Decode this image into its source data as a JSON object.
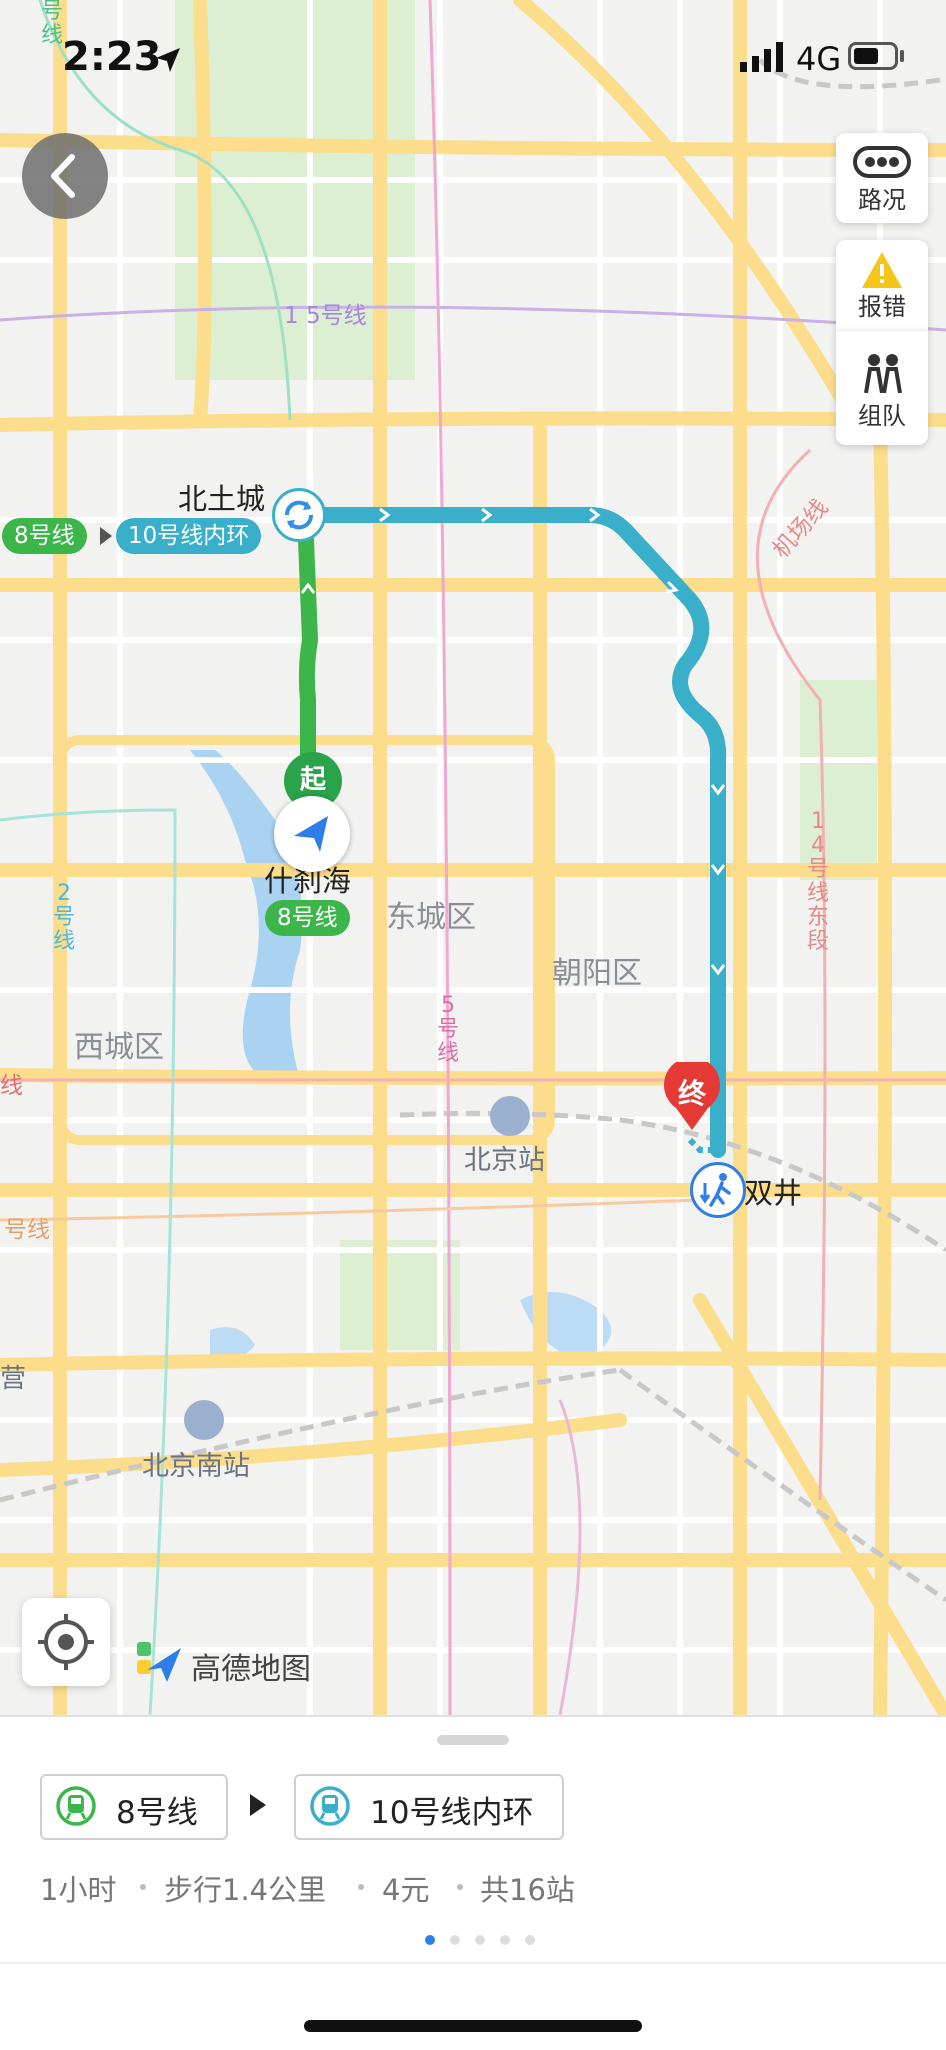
{
  "status_bar": {
    "time": "2:23",
    "network": "4G",
    "location_arrow_icon": "location-arrow-icon",
    "signal_icon": "signal-bars-icon",
    "battery_icon": "battery-icon"
  },
  "map": {
    "buttons": {
      "back_icon": "chevron-left-icon",
      "traffic_label": "路况",
      "report_label": "报错",
      "team_label": "组队",
      "locate_icon": "crosshair-icon"
    },
    "brand": "高德地图",
    "stations": {
      "start_name": "什刹海",
      "transfer_name": "北土城",
      "end_name": "双井",
      "start_marker": "起",
      "end_marker": "终"
    },
    "route_tags": {
      "line8": "8号线",
      "line10": "10号线内环",
      "line8_at_start": "8号线"
    },
    "districts": [
      "东城区",
      "朝阳区",
      "西城区"
    ],
    "poi": {
      "beijing_station": "北京站",
      "beijing_south_station": "北京南站",
      "partial_ying": "营"
    },
    "subway_lines": {
      "line15": "1 5号线",
      "airport": "机场线",
      "line14": "1 4号线东段",
      "line2": "2号线",
      "line5": "5号线",
      "top_left": "号线",
      "left_mid": "线",
      "left_low": "号线"
    },
    "colors": {
      "line8": "#3cb54a",
      "line10": "#3aafc9",
      "end_marker": "#e53935"
    }
  },
  "bottom_sheet": {
    "first_line": "8号线",
    "second_line": "10号线内环",
    "duration": "1小时",
    "walking": "步行1.4公里",
    "fare": "4元",
    "stops": "共16站",
    "page_count": 5,
    "active_page": 1
  }
}
